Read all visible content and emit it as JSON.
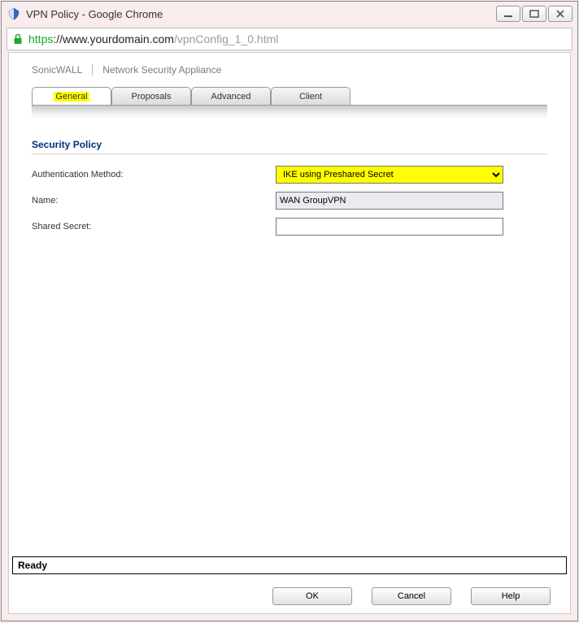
{
  "window": {
    "title": "VPN Policy - Google Chrome"
  },
  "url": {
    "proto": "https",
    "host": "://www.yourdomain.com",
    "path": "/vpnConfig_1_0.html"
  },
  "brand": {
    "vendor": "SonicWALL",
    "product": "Network Security Appliance"
  },
  "tabs": [
    {
      "label": "General",
      "active": true
    },
    {
      "label": "Proposals",
      "active": false
    },
    {
      "label": "Advanced",
      "active": false
    },
    {
      "label": "Client",
      "active": false
    }
  ],
  "section": {
    "title": "Security Policy",
    "auth_label": "Authentication Method:",
    "auth_value": "IKE using Preshared Secret",
    "name_label": "Name:",
    "name_value": "WAN GroupVPN",
    "secret_label": "Shared Secret:",
    "secret_value": ""
  },
  "status": "Ready",
  "buttons": {
    "ok": "OK",
    "cancel": "Cancel",
    "help": "Help"
  }
}
